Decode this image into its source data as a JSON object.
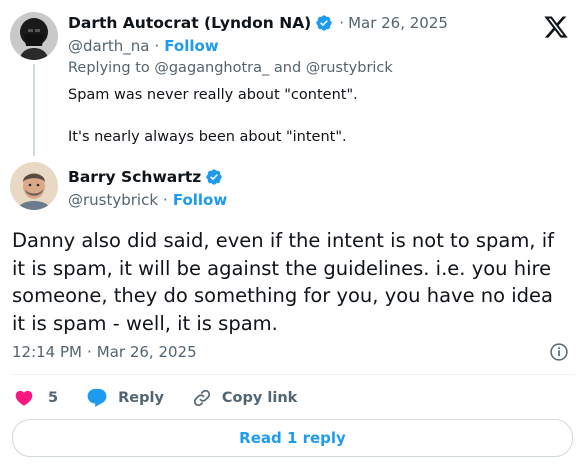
{
  "parent_tweet": {
    "author_name": "Darth Autocrat (Lyndon NA)",
    "verified_icon": "verified-badge-icon",
    "separator": "·",
    "timestamp": "Mar 26, 2025",
    "handle": "@darth_na",
    "handle_separator": "·",
    "follow_label": "Follow",
    "replying_to": "Replying to @gaganghotra_ and @rustybrick",
    "text_line_1": "Spam was never really about \"content\".",
    "text_line_2": "It's nearly always been about \"intent\"."
  },
  "brand": {
    "logo_icon": "x-logo-icon"
  },
  "main_tweet": {
    "author_name": "Barry Schwartz",
    "verified_icon": "verified-badge-icon",
    "handle": "@rustybrick",
    "handle_separator": "·",
    "follow_label": "Follow",
    "body_lines": [
      "Danny also did said, even if the intent is not to spam, if",
      "it is spam, it will be against the guidelines.  i.e. you hire",
      "someone, they do something for you, you have no idea",
      "it is spam - well, it is spam."
    ],
    "time": "12:14 PM",
    "date_separator": "·",
    "date": "Mar 26, 2025",
    "info_icon": "info-icon"
  },
  "actions": {
    "like_icon": "heart-icon",
    "like_count": "5",
    "reply_icon": "reply-bubble-icon",
    "reply_label": "Reply",
    "copy_icon": "link-icon",
    "copy_label": "Copy link"
  },
  "read_replies": {
    "label": "Read 1 reply"
  },
  "colors": {
    "accent": "#1d9bf0",
    "like": "#f91880",
    "text_primary": "#0f1419",
    "text_secondary": "#536471",
    "border": "#cfd9de"
  }
}
